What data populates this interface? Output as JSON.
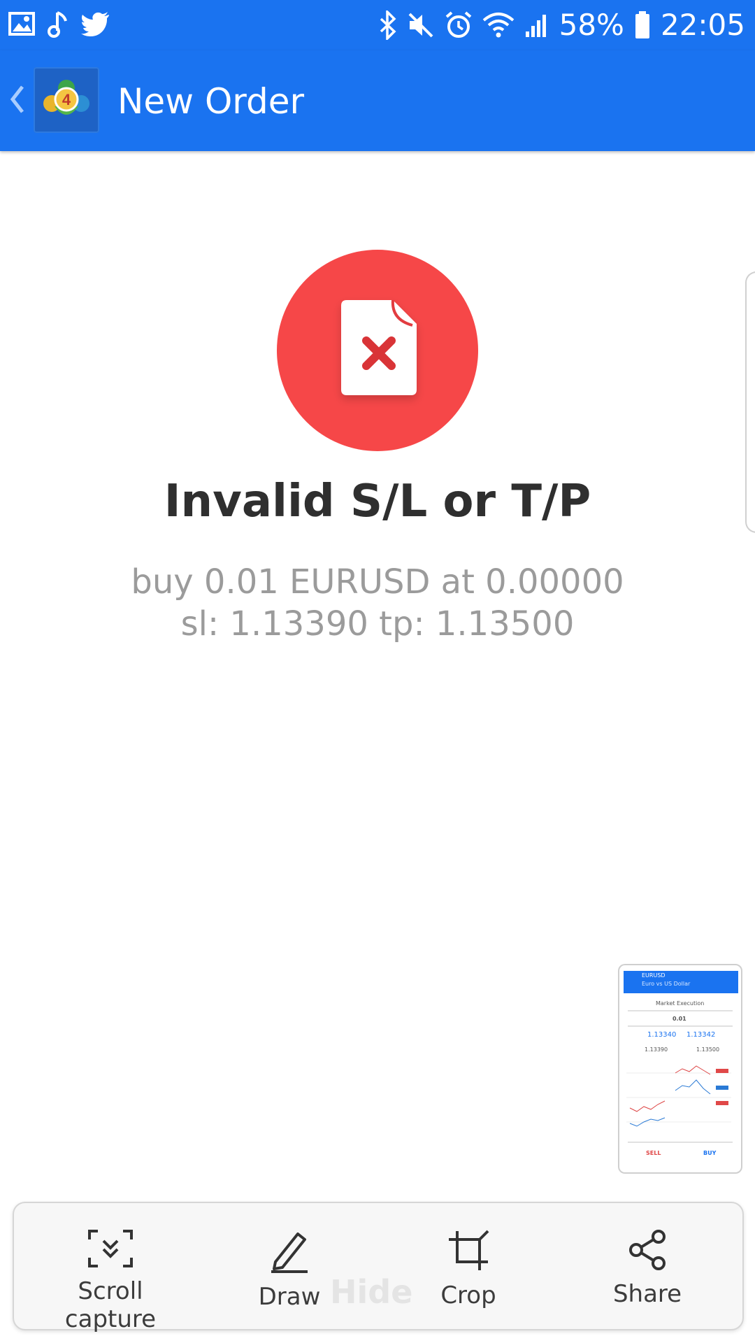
{
  "status_bar": {
    "battery": "58%",
    "time": "22:05",
    "left_icons": [
      "gallery-icon",
      "music-note-icon",
      "twitter-icon"
    ],
    "right_icons": [
      "bluetooth-icon",
      "mute-icon",
      "alarm-icon",
      "wifi-icon",
      "signal-icon",
      "battery-icon"
    ]
  },
  "app_bar": {
    "title": "New Order",
    "back_icon": "chevron-left-icon",
    "logo": "metatrader-4-logo",
    "color": "#1a73f0"
  },
  "result": {
    "icon": "file-error-icon",
    "icon_color": "#f64748",
    "title": "Invalid S/L or T/P",
    "detail_line1": "buy 0.01 EURUSD at 0.00000",
    "detail_line2": "sl: 1.13390 tp: 1.13500"
  },
  "thumbnail": {
    "header": "EURUSD",
    "subheader": "Euro vs US Dollar",
    "mode": "Market Execution",
    "volume": "0.01",
    "sell_price": "1.13340",
    "buy_price": "1.13342",
    "sl": "1.13390",
    "tp": "1.13500",
    "sell_label": "SELL",
    "buy_label": "BUY"
  },
  "toolbar": {
    "items": [
      {
        "label": "Scroll capture",
        "icon": "scroll-capture-icon"
      },
      {
        "label": "Draw",
        "icon": "pen-icon"
      },
      {
        "label": "Crop",
        "icon": "crop-icon"
      },
      {
        "label": "Share",
        "icon": "share-icon"
      }
    ],
    "hide_label": "Hide"
  }
}
